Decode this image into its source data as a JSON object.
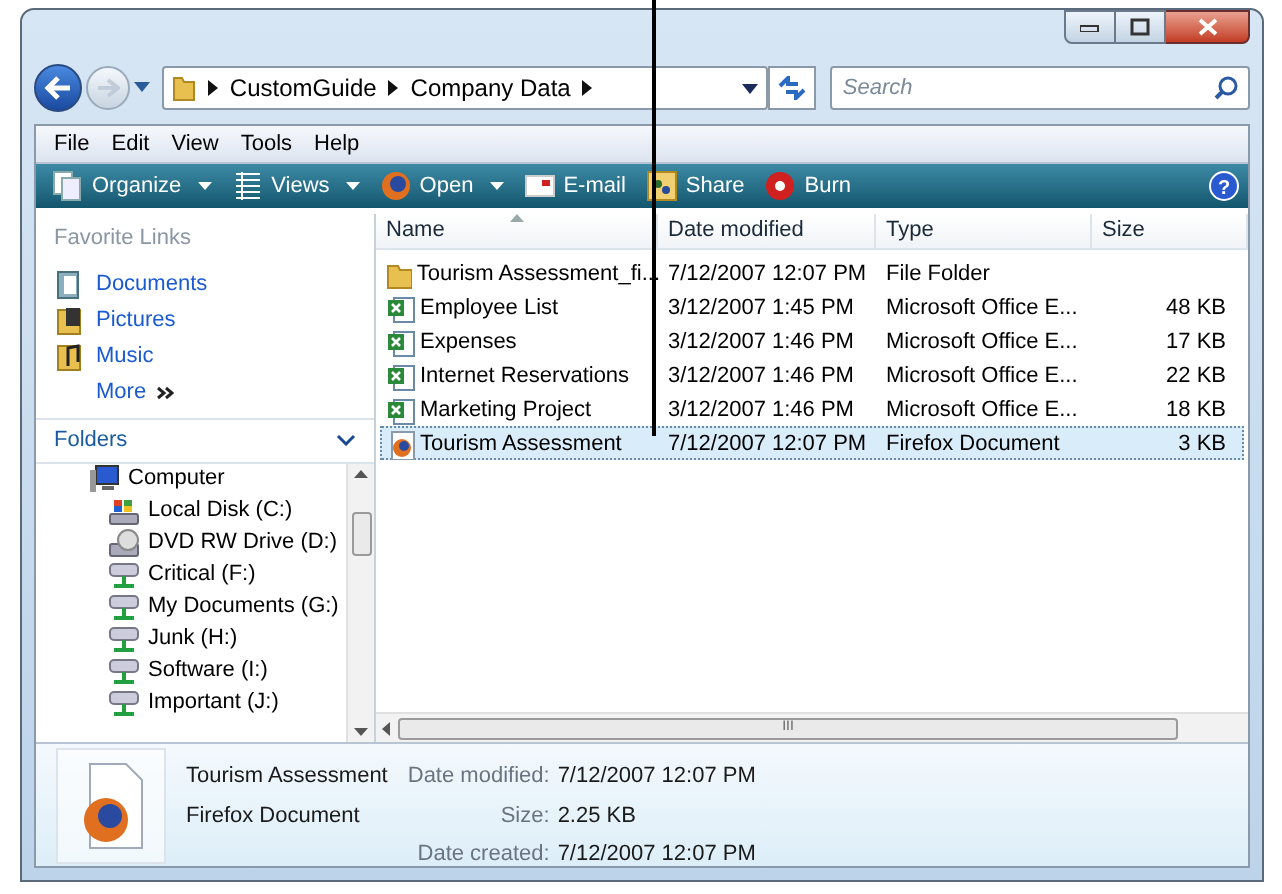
{
  "address": {
    "crumbs": [
      "CustomGuide",
      "Company Data"
    ]
  },
  "search": {
    "placeholder": "Search"
  },
  "menu": [
    "File",
    "Edit",
    "View",
    "Tools",
    "Help"
  ],
  "toolbar": [
    {
      "label": "Organize",
      "kind": "organize",
      "dropdown": true
    },
    {
      "label": "Views",
      "kind": "views",
      "dropdown": true
    },
    {
      "label": "Open",
      "kind": "open",
      "dropdown": true
    },
    {
      "label": "E-mail",
      "kind": "email",
      "dropdown": false
    },
    {
      "label": "Share",
      "kind": "share",
      "dropdown": false
    },
    {
      "label": "Burn",
      "kind": "burn",
      "dropdown": false
    }
  ],
  "favorite_links": {
    "title": "Favorite Links",
    "items": [
      {
        "label": "Documents",
        "kind": "documents"
      },
      {
        "label": "Pictures",
        "kind": "pictures"
      },
      {
        "label": "Music",
        "kind": "music"
      }
    ],
    "more": "More"
  },
  "folders": {
    "title": "Folders",
    "items": [
      {
        "label": "Computer",
        "kind": "computer",
        "children": [
          {
            "label": "Local Disk (C:)",
            "kind": "disk"
          },
          {
            "label": "DVD RW Drive (D:)",
            "kind": "dvd"
          },
          {
            "label": "Critical (F:)",
            "kind": "network"
          },
          {
            "label": "My Documents (G:)",
            "kind": "network"
          },
          {
            "label": "Junk (H:)",
            "kind": "network"
          },
          {
            "label": "Software (I:)",
            "kind": "network"
          },
          {
            "label": "Important (J:)",
            "kind": "network"
          }
        ]
      }
    ]
  },
  "table": {
    "columns": [
      "Name",
      "Date modified",
      "Type",
      "Size"
    ],
    "rows": [
      {
        "name": "Tourism Assessment_fi...",
        "date": "7/12/2007 12:07 PM",
        "type": "File Folder",
        "size": "",
        "kind": "folder",
        "selected": false
      },
      {
        "name": "Employee List",
        "date": "3/12/2007 1:45 PM",
        "type": "Microsoft Office E...",
        "size": "48 KB",
        "kind": "excel",
        "selected": false
      },
      {
        "name": "Expenses",
        "date": "3/12/2007 1:46 PM",
        "type": "Microsoft Office E...",
        "size": "17 KB",
        "kind": "excel",
        "selected": false
      },
      {
        "name": "Internet Reservations",
        "date": "3/12/2007 1:46 PM",
        "type": "Microsoft Office E...",
        "size": "22 KB",
        "kind": "excel",
        "selected": false
      },
      {
        "name": "Marketing Project",
        "date": "3/12/2007 1:46 PM",
        "type": "Microsoft Office E...",
        "size": "18 KB",
        "kind": "excel",
        "selected": false
      },
      {
        "name": "Tourism Assessment",
        "date": "7/12/2007 12:07 PM",
        "type": "Firefox Document",
        "size": "3 KB",
        "kind": "firefox",
        "selected": true
      }
    ]
  },
  "details": {
    "name": "Tourism Assessment",
    "type": "Firefox Document",
    "fields": [
      {
        "label": "Date modified:",
        "value": "7/12/2007 12:07 PM"
      },
      {
        "label": "Size:",
        "value": "2.25 KB"
      },
      {
        "label": "Date created:",
        "value": "7/12/2007 12:07 PM"
      }
    ]
  },
  "scrollbar_grip": "III",
  "help": "?"
}
